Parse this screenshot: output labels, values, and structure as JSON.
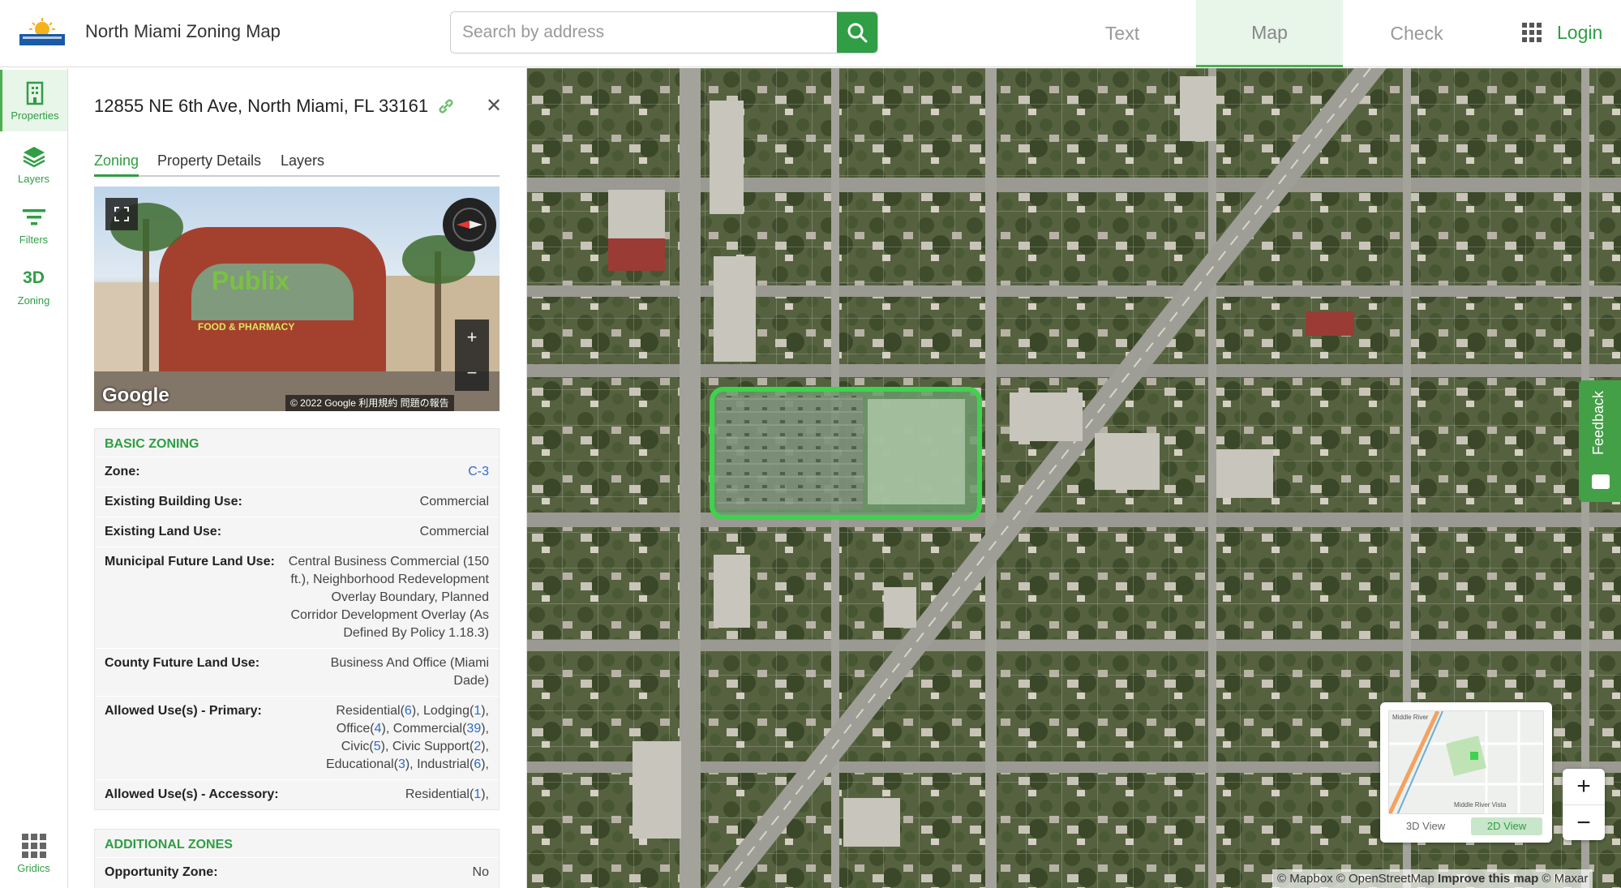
{
  "header": {
    "app_title": "North Miami Zoning Map",
    "search_placeholder": "Search by address",
    "nav": [
      {
        "label": "Text",
        "active": false
      },
      {
        "label": "Map",
        "active": true
      },
      {
        "label": "Check",
        "active": false
      }
    ],
    "login_label": "Login"
  },
  "rail": {
    "items": [
      {
        "label": "Properties",
        "icon": "building-icon",
        "active": true
      },
      {
        "label": "Layers",
        "icon": "layers-icon",
        "active": false
      },
      {
        "label": "Filters",
        "icon": "filter-icon",
        "active": false
      },
      {
        "label": "Zoning",
        "badge": "3D",
        "icon": "3d-icon",
        "active": false
      }
    ],
    "bottom_item": {
      "label": "Gridics",
      "icon": "grid-icon"
    }
  },
  "panel": {
    "address": "12855 NE 6th Ave, North Miami, FL 33161",
    "tabs": [
      {
        "label": "Zoning",
        "active": true
      },
      {
        "label": "Property Details",
        "active": false
      },
      {
        "label": "Layers",
        "active": false
      }
    ],
    "streetview": {
      "google_label": "Google",
      "credits": "© 2022 Google   利用規約   問題の報告",
      "sign_text": "Publix",
      "sign_sub": "FOOD & PHARMACY"
    },
    "basic_zoning": {
      "title": "BASIC ZONING",
      "zone_label": "Zone:",
      "zone_value": "C-3",
      "building_use_label": "Existing Building Use:",
      "building_use_value": "Commercial",
      "land_use_label": "Existing Land Use:",
      "land_use_value": "Commercial",
      "municipal_flu_label": "Municipal Future Land Use:",
      "municipal_flu_value": "Central Business Commercial (150 ft.), Neighborhood Redevelopment Overlay Boundary, Planned Corridor Development Overlay (As Defined By Policy 1.18.3)",
      "county_flu_label": "County Future Land Use:",
      "county_flu_value": "Business And Office (Miami Dade)",
      "primary_label": "Allowed Use(s) - Primary:",
      "primary_uses": [
        {
          "name": "Residential",
          "count": "6"
        },
        {
          "name": "Lodging",
          "count": "1"
        },
        {
          "name": "Office",
          "count": "4"
        },
        {
          "name": "Commercial",
          "count": "39"
        },
        {
          "name": "Civic",
          "count": "5"
        },
        {
          "name": "Civic Support",
          "count": "2"
        },
        {
          "name": "Educational",
          "count": "3"
        },
        {
          "name": "Industrial",
          "count": "6"
        }
      ],
      "accessory_label": "Allowed Use(s) - Accessory:",
      "accessory_uses": [
        {
          "name": "Residential",
          "count": "1"
        }
      ]
    },
    "additional_zones": {
      "title": "ADDITIONAL ZONES",
      "opportunity_label": "Opportunity Zone:",
      "opportunity_value": "No"
    }
  },
  "map": {
    "feedback_label": "Feedback",
    "minimap": {
      "labels": [
        "Middle River",
        "Middle River Vista"
      ],
      "view_3d": "3D View",
      "view_2d": "2D View",
      "active_view": "2D View"
    },
    "zoom_in": "+",
    "zoom_out": "−",
    "attribution_prefix": "© Mapbox © OpenStreetMap",
    "attribution_improve": "Improve this map",
    "attribution_suffix": "© Maxar"
  },
  "colors": {
    "brand_green": "#2f9e44",
    "selection_outline": "#3fd24f",
    "link_blue": "#2d6cc4"
  }
}
